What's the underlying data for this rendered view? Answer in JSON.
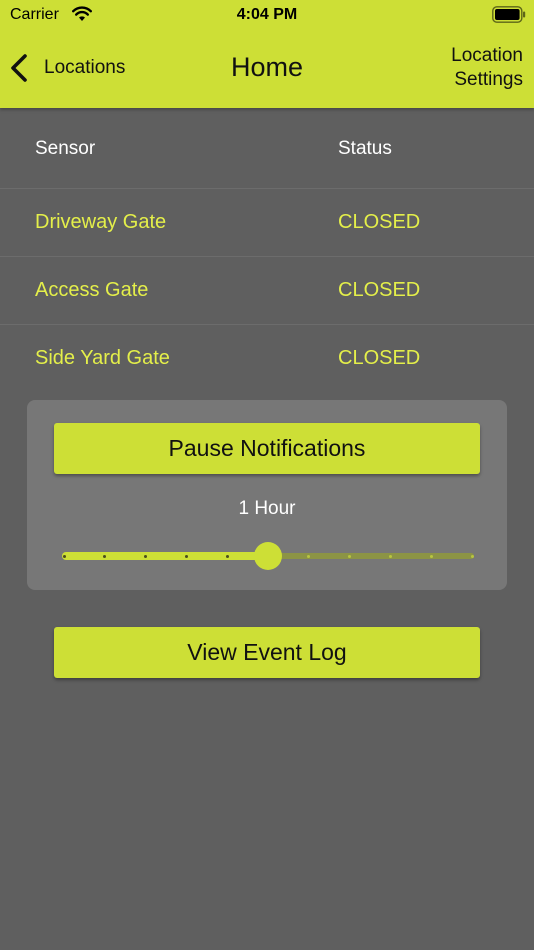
{
  "status_bar": {
    "carrier": "Carrier",
    "time": "4:04 PM",
    "wifi_icon": "wifi-icon",
    "battery_icon": "battery-icon"
  },
  "nav": {
    "back_label": "Locations",
    "title": "Home",
    "settings_line1": "Location",
    "settings_line2": "Settings"
  },
  "table": {
    "headers": {
      "sensor": "Sensor",
      "status": "Status"
    },
    "rows": [
      {
        "sensor": "Driveway Gate",
        "status": "CLOSED"
      },
      {
        "sensor": "Access Gate",
        "status": "CLOSED"
      },
      {
        "sensor": "Side Yard Gate",
        "status": "CLOSED"
      }
    ]
  },
  "pause_panel": {
    "button_label": "Pause Notifications",
    "slider_value_label": "1 Hour",
    "slider": {
      "steps": 11,
      "selected_index": 5
    }
  },
  "event_log_label": "View Event Log",
  "colors": {
    "accent": "#cddf36",
    "background": "#5f5f5f",
    "panel": "#777777",
    "sensor_text": "#e4ef4a"
  }
}
